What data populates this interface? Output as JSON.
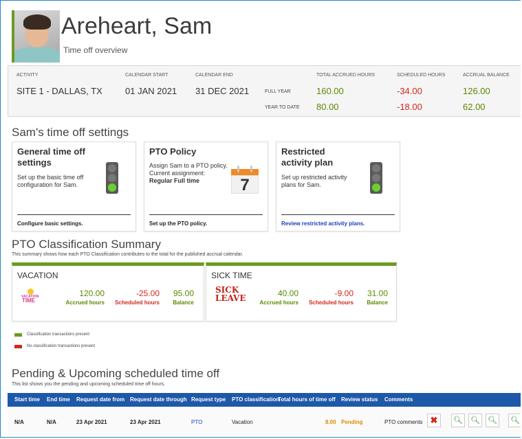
{
  "header": {
    "name": "Areheart, Sam",
    "subtitle": "Time off overview"
  },
  "activity": {
    "labels": {
      "activity": "ACTIVITY",
      "calendar_start": "CALENDAR START",
      "calendar_end": "CALENDAR END",
      "total_accrued": "TOTAL ACCRUED HOURS",
      "scheduled": "SCHEDULED HOURS",
      "balance": "ACCRUAL BALANCE"
    },
    "site": "SITE 1 - DALLAS, TX",
    "start": "01 JAN 2021",
    "end": "31 DEC 2021",
    "rows": [
      {
        "label": "FULL YEAR",
        "accrued": "160.00",
        "scheduled": "-34.00",
        "balance": "126.00"
      },
      {
        "label": "YEAR TO DATE",
        "accrued": "80.00",
        "scheduled": "-18.00",
        "balance": "62.00"
      }
    ]
  },
  "settings": {
    "title": "Sam's time off settings",
    "cards": [
      {
        "title": "General time off settings",
        "desc": "Set up the basic time off configuration for Sam.",
        "link": "Configure basic settings."
      },
      {
        "title": "PTO Policy",
        "desc1": "Assign Sam to a PTO policy.",
        "desc2": "Current assignment:",
        "assignment": "Regular Full time",
        "calendar_day": "7",
        "link": "Set up the PTO policy."
      },
      {
        "title": "Restricted activity plan",
        "desc": "Set up restricted activity plans for Sam.",
        "link": "Review restricted activity plans."
      }
    ]
  },
  "classification": {
    "title": "PTO Classification Summary",
    "subtitle": "This summary shows how each PTO Classification contributes to the total for the published accrual calendar.",
    "cards": [
      {
        "name": "VACATION",
        "badge": "VACATION TIME",
        "accrued": "120.00",
        "scheduled": "-25.00",
        "balance": "95.00"
      },
      {
        "name": "SICK TIME",
        "badge": "SICK LEAVE",
        "accrued": "40.00",
        "scheduled": "-9.00",
        "balance": "31.00"
      }
    ],
    "labels": {
      "accrued": "Accrued hours",
      "scheduled": "Scheduled hours",
      "balance": "Balance"
    },
    "legend": [
      {
        "color": "#6c9b20",
        "text": "Classification transactions present"
      },
      {
        "color": "#d0281b",
        "text": "No classification transactions present"
      }
    ]
  },
  "pending": {
    "title": "Pending & Upcoming scheduled time off",
    "subtitle": "This list shows you the pending and upcoming scheduled time off hours.",
    "columns": [
      "Start time",
      "End time",
      "Request date from",
      "Request date through",
      "Request type",
      "PTO classification",
      "Total hours of time off",
      "Review status",
      "Comments"
    ],
    "rows": [
      {
        "start": "N/A",
        "end": "N/A",
        "from": "23 Apr 2021",
        "through": "23 Apr 2021",
        "type": "PTO",
        "classification": "Vacation",
        "hours": "8.00",
        "status": "Pending",
        "comments": "PTO comments"
      }
    ]
  },
  "colors": {
    "accent": "#6c9b20",
    "header_bar": "#1d59a8",
    "negative": "#d0281b",
    "positive": "#5a8a00",
    "pending": "#e08a00"
  },
  "icons": [
    "profile-photo",
    "traffic-light-icon",
    "calendar-icon",
    "delete-icon",
    "approve-icon"
  ]
}
